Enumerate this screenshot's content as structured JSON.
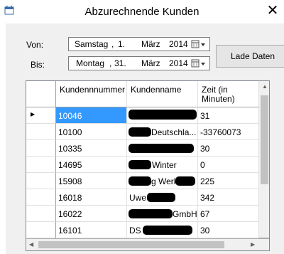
{
  "window": {
    "title": "Abzurechnende Kunden",
    "close_glyph": "✕"
  },
  "filters": {
    "from_label": "Von:",
    "to_label": "Bis:",
    "from_date": {
      "weekday": "Samstag",
      "day": "1.",
      "month": "März",
      "year": "2014"
    },
    "to_date": {
      "weekday": "Montag",
      "day": "31.",
      "month": "März",
      "year": "2014"
    },
    "separator": ","
  },
  "load_button": {
    "label": "Lade Daten"
  },
  "grid": {
    "columns": [
      "Kundennnummer",
      "Kundenname",
      "Zeit (in Minuten)"
    ],
    "current_row_glyph": "▶",
    "rows": [
      {
        "nummer": "10046",
        "name": "",
        "zeit": "31"
      },
      {
        "nummer": "10100",
        "name": "Deutschla...",
        "zeit": "-33760073"
      },
      {
        "nummer": "10335",
        "name": "",
        "zeit": "30"
      },
      {
        "nummer": "14695",
        "name": "Winter",
        "zeit": "0"
      },
      {
        "nummer": "15908",
        "name": "g Werk",
        "zeit": "225"
      },
      {
        "nummer": "16018",
        "name": "Uwe",
        "zeit": "342"
      },
      {
        "nummer": "16022",
        "name": "GmbH",
        "zeit": "67"
      },
      {
        "nummer": "16101",
        "name": "DS",
        "zeit": "30"
      }
    ]
  },
  "icons": [
    "app-calendar-icon",
    "calendar-dropdown-icon",
    "row-indicator-icon",
    "scroll-arrow-icon"
  ]
}
